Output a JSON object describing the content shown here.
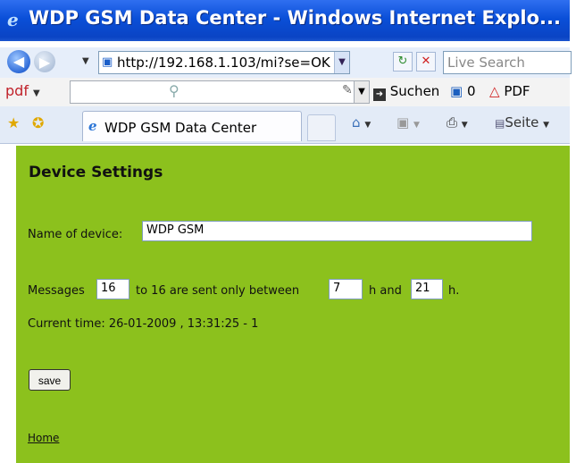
{
  "window": {
    "title": "WDP GSM Data Center - Windows Internet Explo..."
  },
  "address_bar": {
    "url": "http://192.168.1.103/mi?se=OK",
    "search_placeholder": "Live Search"
  },
  "pdf_toolbar": {
    "label": "pdf",
    "search_label": "Suchen",
    "count": "0",
    "pdf_label": "PDF"
  },
  "tabs": [
    {
      "label": "WDP GSM Data Center"
    }
  ],
  "command_bar": {
    "page_label": "Seite"
  },
  "page": {
    "heading": "Device Settings",
    "name_label": "Name of device:",
    "name_value": "WDP GSM",
    "messages_label": "Messages",
    "messages_from": "16",
    "messages_middle": "to 16 are sent only between",
    "hour_from": "7",
    "hour_and": "h and",
    "hour_to": "21",
    "hour_suffix": "h.",
    "current_time": "Current time: 26-01-2009 , 13:31:25 - 1",
    "save_label": "save",
    "home_link": "Home"
  },
  "colors": {
    "content_bg": "#8cc11d",
    "titlebar": "#0a4fd8"
  }
}
